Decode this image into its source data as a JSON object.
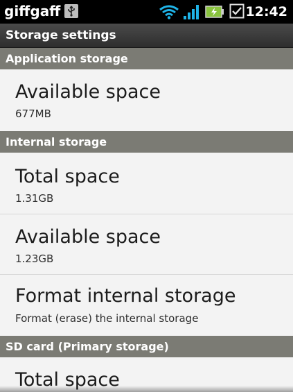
{
  "status_bar": {
    "carrier": "giffgaff",
    "time": "12:42",
    "icons": [
      "usb-icon",
      "wifi-icon",
      "signal-icon",
      "battery-charging-icon",
      "checkbox-icon"
    ]
  },
  "header": {
    "title": "Storage settings"
  },
  "sections": [
    {
      "title": "Application storage",
      "items": [
        {
          "title": "Available space",
          "value": "677MB"
        }
      ]
    },
    {
      "title": "Internal storage",
      "items": [
        {
          "title": "Total space",
          "value": "1.31GB"
        },
        {
          "title": "Available space",
          "value": "1.23GB"
        },
        {
          "title": "Format internal storage",
          "value": "Format (erase) the internal storage"
        }
      ]
    },
    {
      "title": "SD card (Primary storage)",
      "items": [
        {
          "title": "Total space",
          "value": ""
        }
      ]
    }
  ],
  "colors": {
    "status_bar_bg": "#000000",
    "section_header_bg": "#7b7b74",
    "list_bg": "#f3f3f3",
    "wifi_accent": "#1fb4e8",
    "battery_accent": "#8ac43f"
  }
}
